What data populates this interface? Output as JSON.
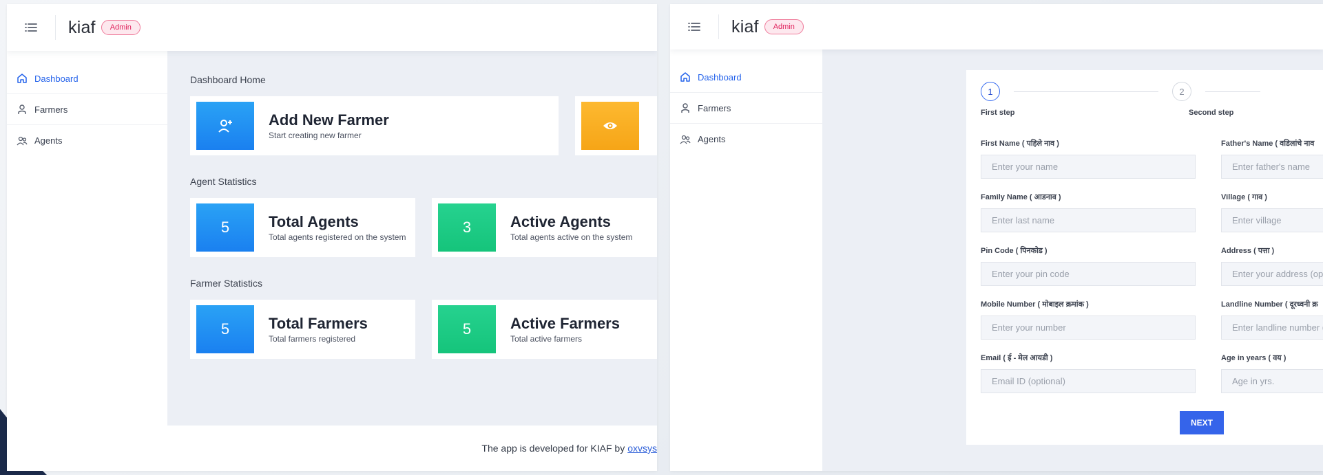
{
  "app": {
    "brand": "kiaf",
    "role_badge": "Admin"
  },
  "sidebar": {
    "items": [
      {
        "label": "Dashboard",
        "icon": "home-icon"
      },
      {
        "label": "Farmers",
        "icon": "user-icon"
      },
      {
        "label": "Agents",
        "icon": "users-icon"
      }
    ]
  },
  "dashboard": {
    "home_title": "Dashboard Home",
    "add_farmer": {
      "title": "Add New Farmer",
      "subtitle": "Start creating new farmer",
      "icon": "user-plus-icon"
    },
    "view_card": {
      "icon": "eye-icon"
    },
    "agent_stats": {
      "title": "Agent Statistics",
      "total": {
        "value": "5",
        "title": "Total Agents",
        "subtitle": "Total agents registered on the system"
      },
      "active": {
        "value": "3",
        "title": "Active Agents",
        "subtitle": "Total agents active on the system"
      }
    },
    "farmer_stats": {
      "title": "Farmer Statistics",
      "total": {
        "value": "5",
        "title": "Total Farmers",
        "subtitle": "Total farmers registered"
      },
      "active": {
        "value": "5",
        "title": "Active Farmers",
        "subtitle": "Total active farmers"
      }
    },
    "footer": {
      "text": "The app is developed for KIAF by",
      "link": "oxvsys"
    }
  },
  "form": {
    "steps": [
      {
        "number": "1",
        "label": "First step"
      },
      {
        "number": "2",
        "label": "Second step"
      }
    ],
    "fields": [
      {
        "label": "First Name ( पहिले नाव )",
        "placeholder": "Enter your name"
      },
      {
        "label": "Father's Name ( वडिलांचे नाव",
        "placeholder": "Enter father's name"
      },
      {
        "label": "Family Name ( आडनाव )",
        "placeholder": "Enter last name"
      },
      {
        "label": "Village ( गाव )",
        "placeholder": "Enter village"
      },
      {
        "label": "Pin Code ( पिनकोड )",
        "placeholder": "Enter your pin code"
      },
      {
        "label": "Address ( पत्ता )",
        "placeholder": "Enter your address (opti"
      },
      {
        "label": "Mobile Number ( मोबाइल क्रमांक )",
        "placeholder": "Enter your number"
      },
      {
        "label": "Landline Number ( दूरध्वनी क्र",
        "placeholder": "Enter landline number (c"
      },
      {
        "label": "Email ( ई - मेल आयडी )",
        "placeholder": "Email ID (optional)"
      },
      {
        "label": "Age in years ( वय )",
        "placeholder": "Age in yrs."
      }
    ],
    "next_label": "NEXT"
  },
  "colors": {
    "accent": "#3564ea",
    "tile_blue": "#1a80f0",
    "tile_green": "#15c47b",
    "tile_orange": "#f6a517",
    "badge": "#e0245e"
  }
}
